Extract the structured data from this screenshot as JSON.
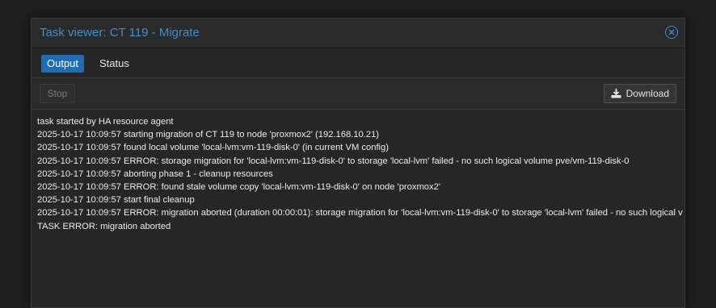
{
  "window": {
    "title": "Task viewer: CT 119 - Migrate"
  },
  "tabs": [
    {
      "label": "Output",
      "active": true
    },
    {
      "label": "Status",
      "active": false
    }
  ],
  "toolbar": {
    "stop_label": "Stop",
    "download_label": "Download"
  },
  "log": [
    "task started by HA resource agent",
    "2025-10-17 10:09:57 starting migration of CT 119 to node 'proxmox2' (192.168.10.21)",
    "2025-10-17 10:09:57 found local volume 'local-lvm:vm-119-disk-0' (in current VM config)",
    "2025-10-17 10:09:57 ERROR: storage migration for 'local-lvm:vm-119-disk-0' to storage 'local-lvm' failed - no such logical volume pve/vm-119-disk-0",
    "2025-10-17 10:09:57 aborting phase 1 - cleanup resources",
    "2025-10-17 10:09:57 ERROR: found stale volume copy 'local-lvm:vm-119-disk-0' on node 'proxmox2'",
    "2025-10-17 10:09:57 start final cleanup",
    "2025-10-17 10:09:57 ERROR: migration aborted (duration 00:00:01): storage migration for 'local-lvm:vm-119-disk-0' to storage 'local-lvm' failed - no such logical v",
    "TASK ERROR: migration aborted"
  ],
  "icons": {
    "close": "close-icon",
    "download": "download-icon"
  },
  "colors": {
    "accent": "#3d8fd1",
    "active_tab": "#1e6db6",
    "background": "#262626"
  }
}
